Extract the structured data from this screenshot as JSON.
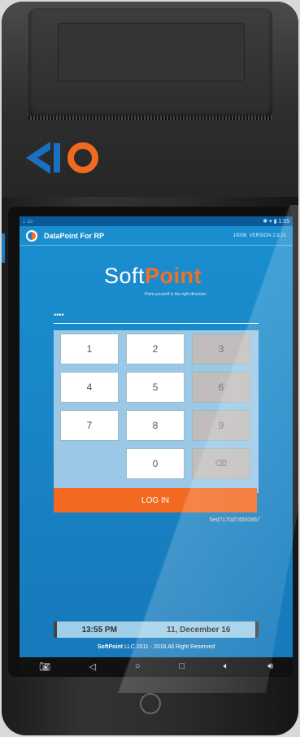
{
  "status_bar": {
    "left_icons": "↓ ▭",
    "right_text": "✱ ▾ ▮ 1:55"
  },
  "app": {
    "title": "DataPoint For RP",
    "id": "10008",
    "version": "VERSION 2.9.21"
  },
  "brand": {
    "soft": "Soft",
    "point": "Point",
    "tagline": "Point yourself in the right direction."
  },
  "pin": {
    "masked_value": "••••"
  },
  "keypad": {
    "keys": [
      "1",
      "2",
      "3",
      "4",
      "5",
      "6",
      "7",
      "8",
      "9",
      "0",
      "⌫"
    ]
  },
  "login_label": "LOG IN",
  "serial": "5ed7170d74550867",
  "footer": {
    "time": "13:55 PM",
    "date": "11, December 16",
    "copyright_brand": "SoftPoint",
    "copyright_text": " LLC 2011 - 2016 All Right Reserved"
  },
  "nav": {
    "items": [
      "camera-icon",
      "back-icon",
      "home-icon",
      "recents-icon",
      "volume-down-icon",
      "volume-up-icon"
    ]
  },
  "colors": {
    "accent": "#f26a21",
    "screen": "#1a8fd0"
  }
}
